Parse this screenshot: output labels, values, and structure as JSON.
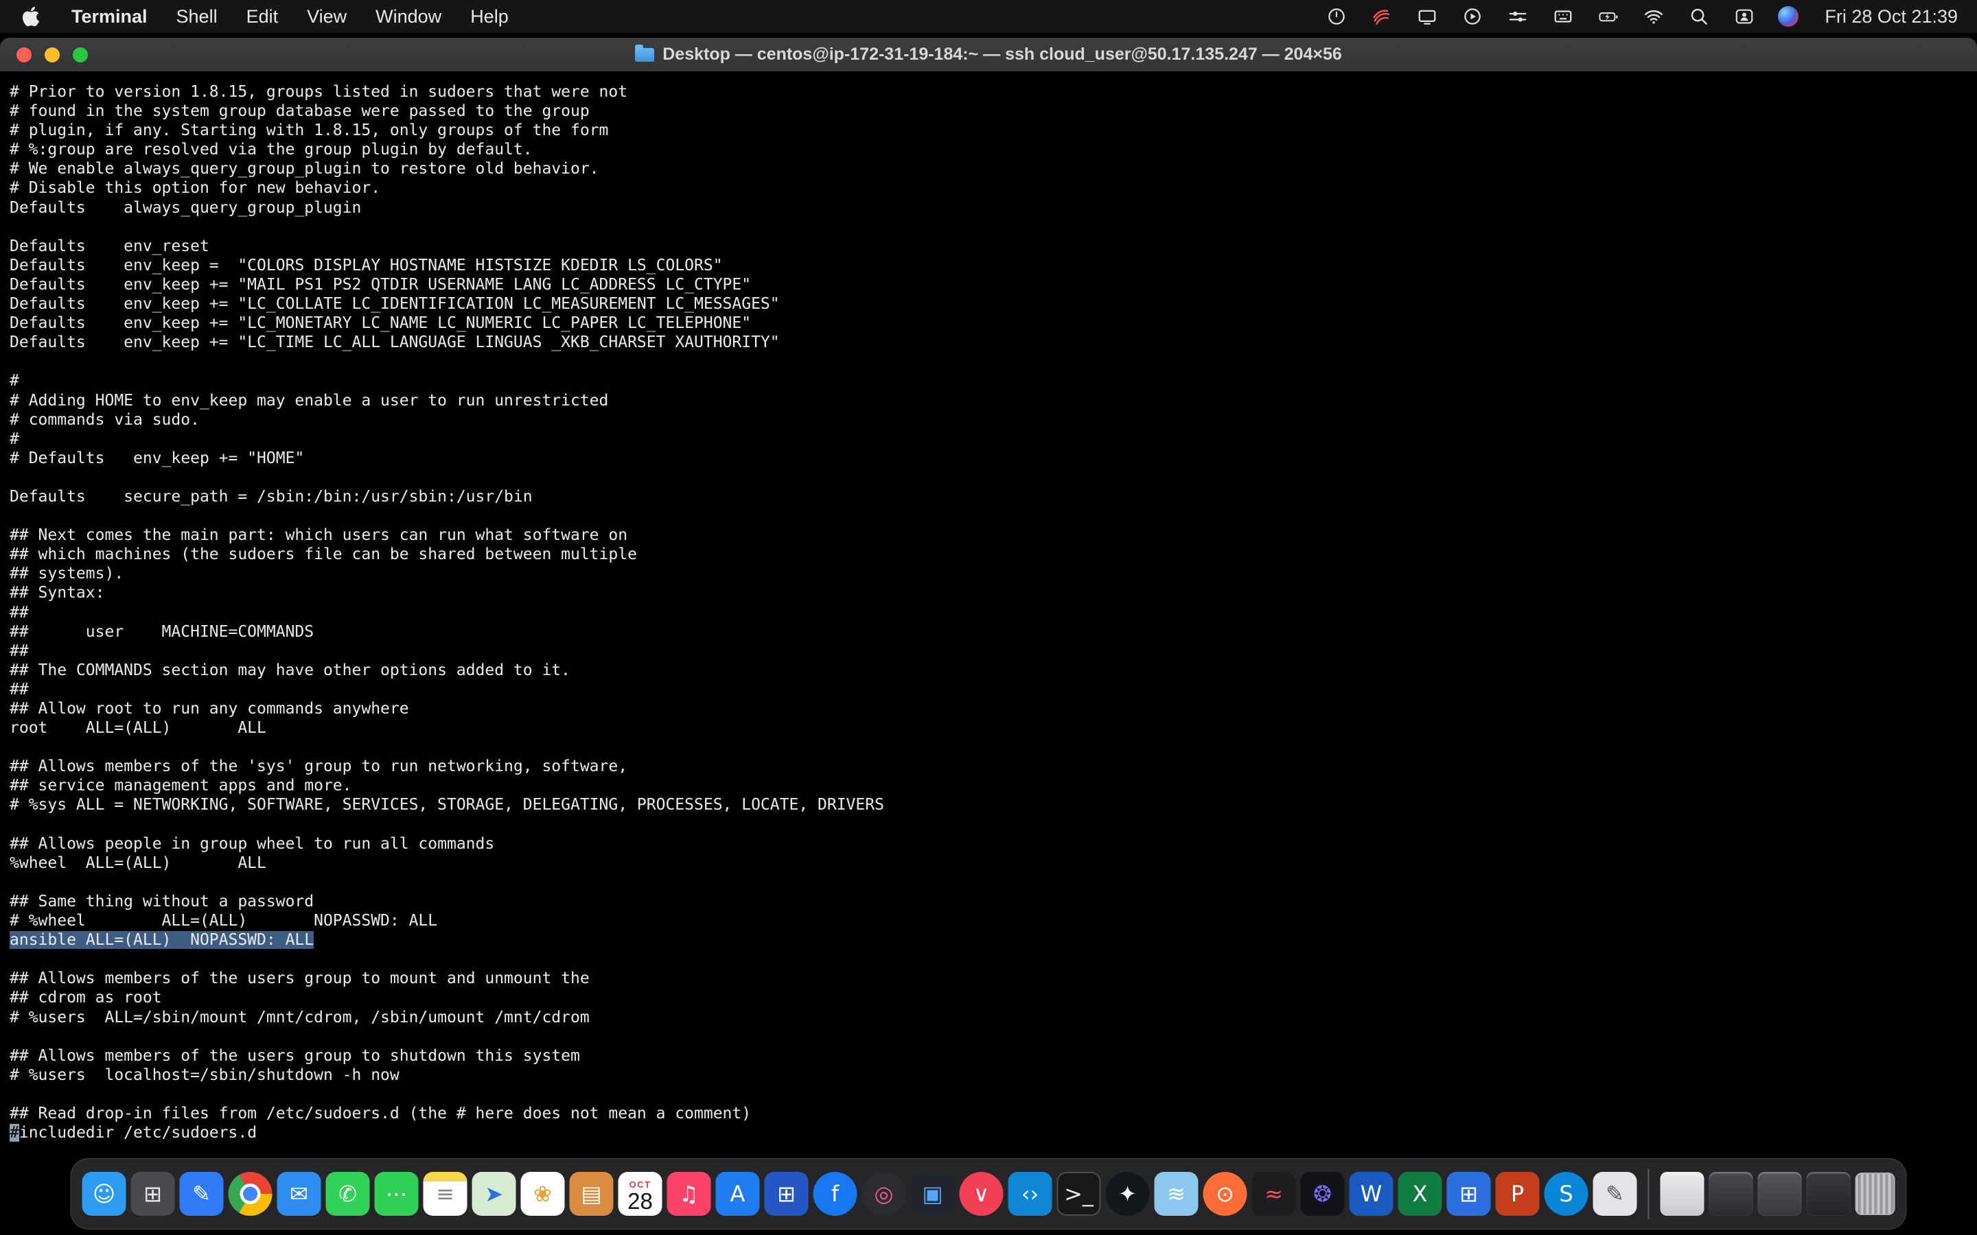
{
  "menu_bar": {
    "app_name": "Terminal",
    "items": [
      "Shell",
      "Edit",
      "View",
      "Window",
      "Help"
    ],
    "status_icons": [
      "power-circle-icon",
      "wireless-diagnostics-icon",
      "display-icon",
      "screen-play-icon",
      "control-sliders-icon",
      "keyboard-icon",
      "battery-charging-icon",
      "wifi-icon",
      "spotlight-search-icon",
      "fast-user-switch-icon",
      "siri-icon"
    ],
    "clock": "Fri 28 Oct 21:39"
  },
  "window": {
    "title": "Desktop — centos@ip-172-31-19-184:~ — ssh cloud_user@50.17.135.247 — 204×56"
  },
  "terminal": {
    "selected_line_index": 44,
    "cursor_line_index": 54,
    "selection_color": "#3e5c82",
    "lines": [
      "# Prior to version 1.8.15, groups listed in sudoers that were not",
      "# found in the system group database were passed to the group",
      "# plugin, if any. Starting with 1.8.15, only groups of the form",
      "# %:group are resolved via the group plugin by default.",
      "# We enable always_query_group_plugin to restore old behavior.",
      "# Disable this option for new behavior.",
      "Defaults    always_query_group_plugin",
      "",
      "Defaults    env_reset",
      "Defaults    env_keep =  \"COLORS DISPLAY HOSTNAME HISTSIZE KDEDIR LS_COLORS\"",
      "Defaults    env_keep += \"MAIL PS1 PS2 QTDIR USERNAME LANG LC_ADDRESS LC_CTYPE\"",
      "Defaults    env_keep += \"LC_COLLATE LC_IDENTIFICATION LC_MEASUREMENT LC_MESSAGES\"",
      "Defaults    env_keep += \"LC_MONETARY LC_NAME LC_NUMERIC LC_PAPER LC_TELEPHONE\"",
      "Defaults    env_keep += \"LC_TIME LC_ALL LANGUAGE LINGUAS _XKB_CHARSET XAUTHORITY\"",
      "",
      "#",
      "# Adding HOME to env_keep may enable a user to run unrestricted",
      "# commands via sudo.",
      "#",
      "# Defaults   env_keep += \"HOME\"",
      "",
      "Defaults    secure_path = /sbin:/bin:/usr/sbin:/usr/bin",
      "",
      "## Next comes the main part: which users can run what software on",
      "## which machines (the sudoers file can be shared between multiple",
      "## systems).",
      "## Syntax:",
      "##",
      "##      user    MACHINE=COMMANDS",
      "##",
      "## The COMMANDS section may have other options added to it.",
      "##",
      "## Allow root to run any commands anywhere",
      "root    ALL=(ALL)       ALL",
      "",
      "## Allows members of the 'sys' group to run networking, software,",
      "## service management apps and more.",
      "# %sys ALL = NETWORKING, SOFTWARE, SERVICES, STORAGE, DELEGATING, PROCESSES, LOCATE, DRIVERS",
      "",
      "## Allows people in group wheel to run all commands",
      "%wheel  ALL=(ALL)       ALL",
      "",
      "## Same thing without a password",
      "# %wheel        ALL=(ALL)       NOPASSWD: ALL",
      "ansible ALL=(ALL)  NOPASSWD: ALL",
      "",
      "## Allows members of the users group to mount and unmount the",
      "## cdrom as root",
      "# %users  ALL=/sbin/mount /mnt/cdrom, /sbin/umount /mnt/cdrom",
      "",
      "## Allows members of the users group to shutdown this system",
      "# %users  localhost=/sbin/shutdown -h now",
      "",
      "## Read drop-in files from /etc/sudoers.d (the # here does not mean a comment)",
      "#includedir /etc/sudoers.d"
    ]
  },
  "dock": {
    "calendar": {
      "month": "OCT",
      "day": "28"
    },
    "apps": [
      {
        "id": "finder",
        "bg": "#2c9bf0",
        "glyph": "☺",
        "fg": "#ffffff"
      },
      {
        "id": "launchpad",
        "bg": "#4a4a4e",
        "glyph": "⊞",
        "fg": "#e8e8e8"
      },
      {
        "id": "preview",
        "bg": "#2f7cf6",
        "glyph": "✎",
        "fg": "#ffffff"
      },
      {
        "id": "chrome",
        "type": "chrome"
      },
      {
        "id": "mail",
        "bg": "#2f8df2",
        "glyph": "✉",
        "fg": "#ffffff"
      },
      {
        "id": "facetime",
        "bg": "#32d158",
        "glyph": "✆",
        "fg": "#ffffff"
      },
      {
        "id": "messages",
        "bg": "#30cf55",
        "glyph": "⋯",
        "fg": "#ffffff"
      },
      {
        "id": "notes",
        "type": "notes",
        "glyph": "≡",
        "fg": "#8a8a8a"
      },
      {
        "id": "maps",
        "bg": "#d6ecd2",
        "glyph": "➤",
        "fg": "#2f6fe0"
      },
      {
        "id": "photos",
        "type": "photos",
        "glyph": "❀",
        "fg": "#f09f2e"
      },
      {
        "id": "files-folder",
        "bg": "#d98b3f",
        "glyph": "▤",
        "fg": "#ffffff"
      },
      {
        "id": "calendar",
        "type": "calendar"
      },
      {
        "id": "music",
        "bg": "#fb4268",
        "glyph": "♫",
        "fg": "#ffffff"
      },
      {
        "id": "app-store",
        "bg": "#1f7cf0",
        "glyph": "A",
        "fg": "#ffffff"
      },
      {
        "id": "remote-desktop",
        "bg": "#2456c4",
        "glyph": "⊞",
        "fg": "#ffffff"
      },
      {
        "id": "facebook",
        "type": "circle",
        "bg": "#1877f2",
        "glyph": "f",
        "fg": "#ffffff"
      },
      {
        "id": "camera-app",
        "type": "circle",
        "bg": "#2b2b30",
        "glyph": "◎",
        "fg": "#e85d8a"
      },
      {
        "id": "virtualbox",
        "bg": "#20242c",
        "glyph": "▣",
        "fg": "#58a6ff"
      },
      {
        "id": "pocket",
        "type": "circle",
        "bg": "#ef4056",
        "glyph": "∨",
        "fg": "#ffffff"
      },
      {
        "id": "vscode",
        "bg": "#0f86d4",
        "glyph": "‹›",
        "fg": "#ffffff"
      },
      {
        "id": "terminal-app",
        "bg": "#18181a",
        "border": "#4c4c50",
        "glyph": ">_",
        "fg": "#e8e8e8"
      },
      {
        "id": "github",
        "type": "circle",
        "bg": "#14171c",
        "glyph": "✦",
        "fg": "#ffffff"
      },
      {
        "id": "docker",
        "bg": "#8cc7ee",
        "glyph": "≋",
        "fg": "#ffffff"
      },
      {
        "id": "postman",
        "type": "circle",
        "bg": "#ff6c37",
        "glyph": "⊙",
        "fg": "#ffffff"
      },
      {
        "id": "wifi-analyzer",
        "bg": "#1d1d20",
        "glyph": "≈",
        "fg": "#ff4f5e"
      },
      {
        "id": "affinity",
        "bg": "#121218",
        "glyph": "❂",
        "fg": "#7a6cff"
      },
      {
        "id": "word",
        "bg": "#185abd",
        "glyph": "W",
        "fg": "#ffffff"
      },
      {
        "id": "excel",
        "bg": "#107c41",
        "glyph": "X",
        "fg": "#ffffff"
      },
      {
        "id": "tiles-app",
        "bg": "#2e6fe0",
        "glyph": "⊞",
        "fg": "#ffffff"
      },
      {
        "id": "powerpoint",
        "bg": "#c43e1c",
        "glyph": "P",
        "fg": "#ffffff"
      },
      {
        "id": "skype",
        "type": "circle",
        "bg": "#0a86d8",
        "glyph": "S",
        "fg": "#ffffff"
      },
      {
        "id": "design-tool",
        "bg": "#e3e3e8",
        "glyph": "✎",
        "fg": "#55555a"
      },
      {
        "id": "separator",
        "type": "separator"
      },
      {
        "id": "downloads-stack",
        "type": "thumb",
        "bg": "linear-gradient(#ececef,#c9c9ce)"
      },
      {
        "id": "minimized-window-1",
        "type": "thumb",
        "bg": "linear-gradient(#4a4a4e,#2c2c30)"
      },
      {
        "id": "minimized-window-2",
        "type": "thumb",
        "bg": "linear-gradient(#55555a,#39393d)"
      },
      {
        "id": "minimized-window-3",
        "type": "thumb",
        "bg": "linear-gradient(#3a3a40,#232327)"
      },
      {
        "id": "trash",
        "type": "trash"
      }
    ]
  }
}
